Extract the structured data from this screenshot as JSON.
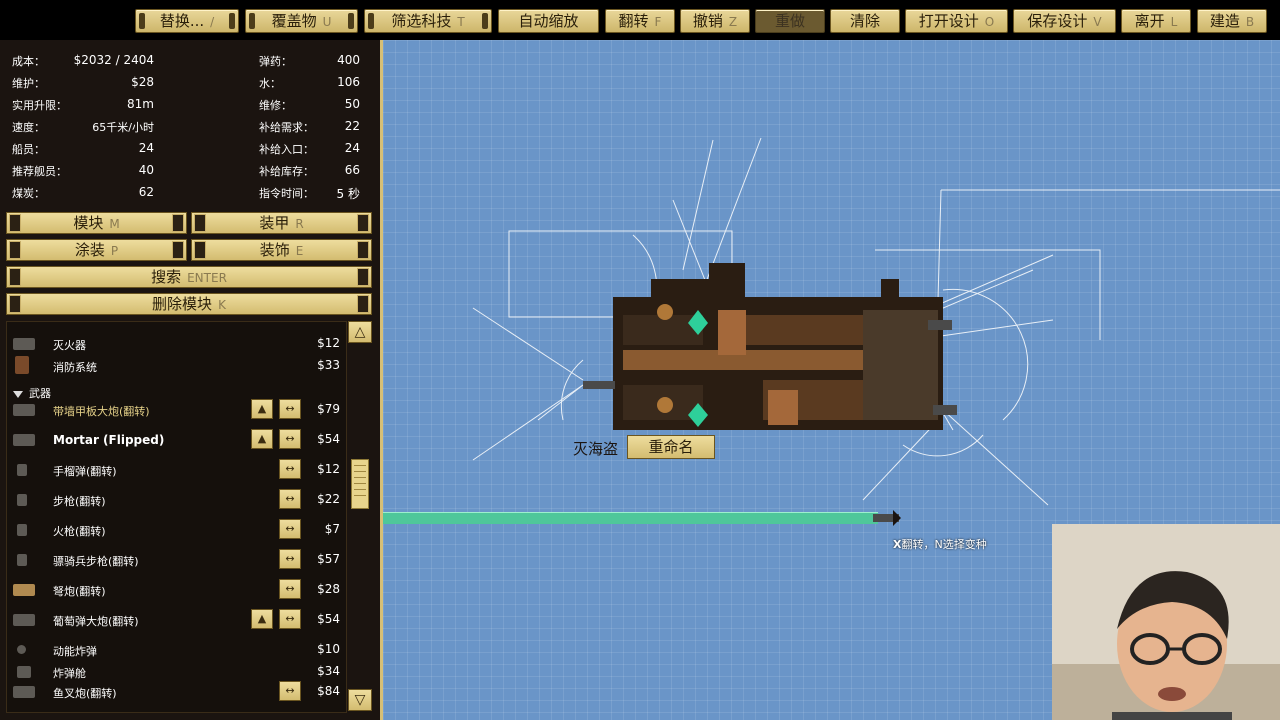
{
  "toolbar": {
    "buttons": [
      {
        "label": "替换...",
        "key": "/"
      },
      {
        "label": "覆盖物",
        "key": "U"
      },
      {
        "label": "筛选科技",
        "key": "T"
      },
      {
        "label": "自动缩放",
        "key": ""
      },
      {
        "label": "翻转",
        "key": "F"
      },
      {
        "label": "撤销",
        "key": "Z"
      },
      {
        "label": "重做",
        "key": ""
      },
      {
        "label": "清除",
        "key": ""
      },
      {
        "label": "打开设计",
        "key": "O"
      },
      {
        "label": "保存设计",
        "key": "V"
      },
      {
        "label": "离开",
        "key": "L"
      },
      {
        "label": "建造",
        "key": "B"
      }
    ]
  },
  "stats": {
    "left": [
      {
        "label": "成本：",
        "value": "$2032 / 2404"
      },
      {
        "label": "维护：",
        "value": "$28"
      },
      {
        "label": "实用升限：",
        "value": "81m"
      },
      {
        "label": "速度：",
        "value": "65千米/小时"
      },
      {
        "label": "船员：",
        "value": "24"
      },
      {
        "label": "推荐舰员：",
        "value": "40"
      },
      {
        "label": "煤炭：",
        "value": "62"
      }
    ],
    "right": [
      {
        "label": "弹药：",
        "value": "400"
      },
      {
        "label": "水：",
        "value": "106"
      },
      {
        "label": "维修：",
        "value": "50"
      },
      {
        "label": "补给需求：",
        "value": "22"
      },
      {
        "label": "补给入口：",
        "value": "24"
      },
      {
        "label": "补给库存：",
        "value": "66"
      },
      {
        "label": "指令时间：",
        "value": "5 秒"
      }
    ]
  },
  "panel_buttons": {
    "modules": {
      "label": "模块",
      "key": "M"
    },
    "armor": {
      "label": "装甲",
      "key": "R"
    },
    "paint": {
      "label": "涂装",
      "key": "P"
    },
    "decor": {
      "label": "装饰",
      "key": "E"
    },
    "search": {
      "label": "搜索",
      "key": "ENTER"
    },
    "delete": {
      "label": "删除模块",
      "key": "K"
    }
  },
  "module_list": {
    "items_top": [
      {
        "name": "灭火器",
        "price": "$12"
      },
      {
        "name": "消防系统",
        "price": "$33"
      }
    ],
    "category": "武器",
    "weapons": [
      {
        "name": "带墙甲板大炮(翻转)",
        "price": "$79"
      },
      {
        "name": "Mortar (Flipped)",
        "price": "$54"
      },
      {
        "name": "手榴弹(翻转)",
        "price": "$12"
      },
      {
        "name": "步枪(翻转)",
        "price": "$22"
      },
      {
        "name": "火枪(翻转)",
        "price": "$7"
      },
      {
        "name": "骠骑兵步枪(翻转)",
        "price": "$57"
      },
      {
        "name": "弩炮(翻转)",
        "price": "$28"
      },
      {
        "name": "葡萄弹大炮(翻转)",
        "price": "$54"
      },
      {
        "name": "动能炸弹",
        "price": "$10"
      },
      {
        "name": "炸弹舱",
        "price": "$34"
      },
      {
        "name": "鱼叉炮(翻转)",
        "price": "$84"
      }
    ]
  },
  "canvas": {
    "ship_name": "灭海盗",
    "rename_label": "重命名",
    "hint": "翻转，N选择变种",
    "hint_key_x": "X",
    "hint_key_n": "N"
  },
  "colors": {
    "canvas_bg": "#6a95c8",
    "panel_bg": "#1b1410",
    "button_gold": "#e0ca86",
    "placement_bar": "#4fc79a",
    "highlight_text": "#e6d28a"
  }
}
